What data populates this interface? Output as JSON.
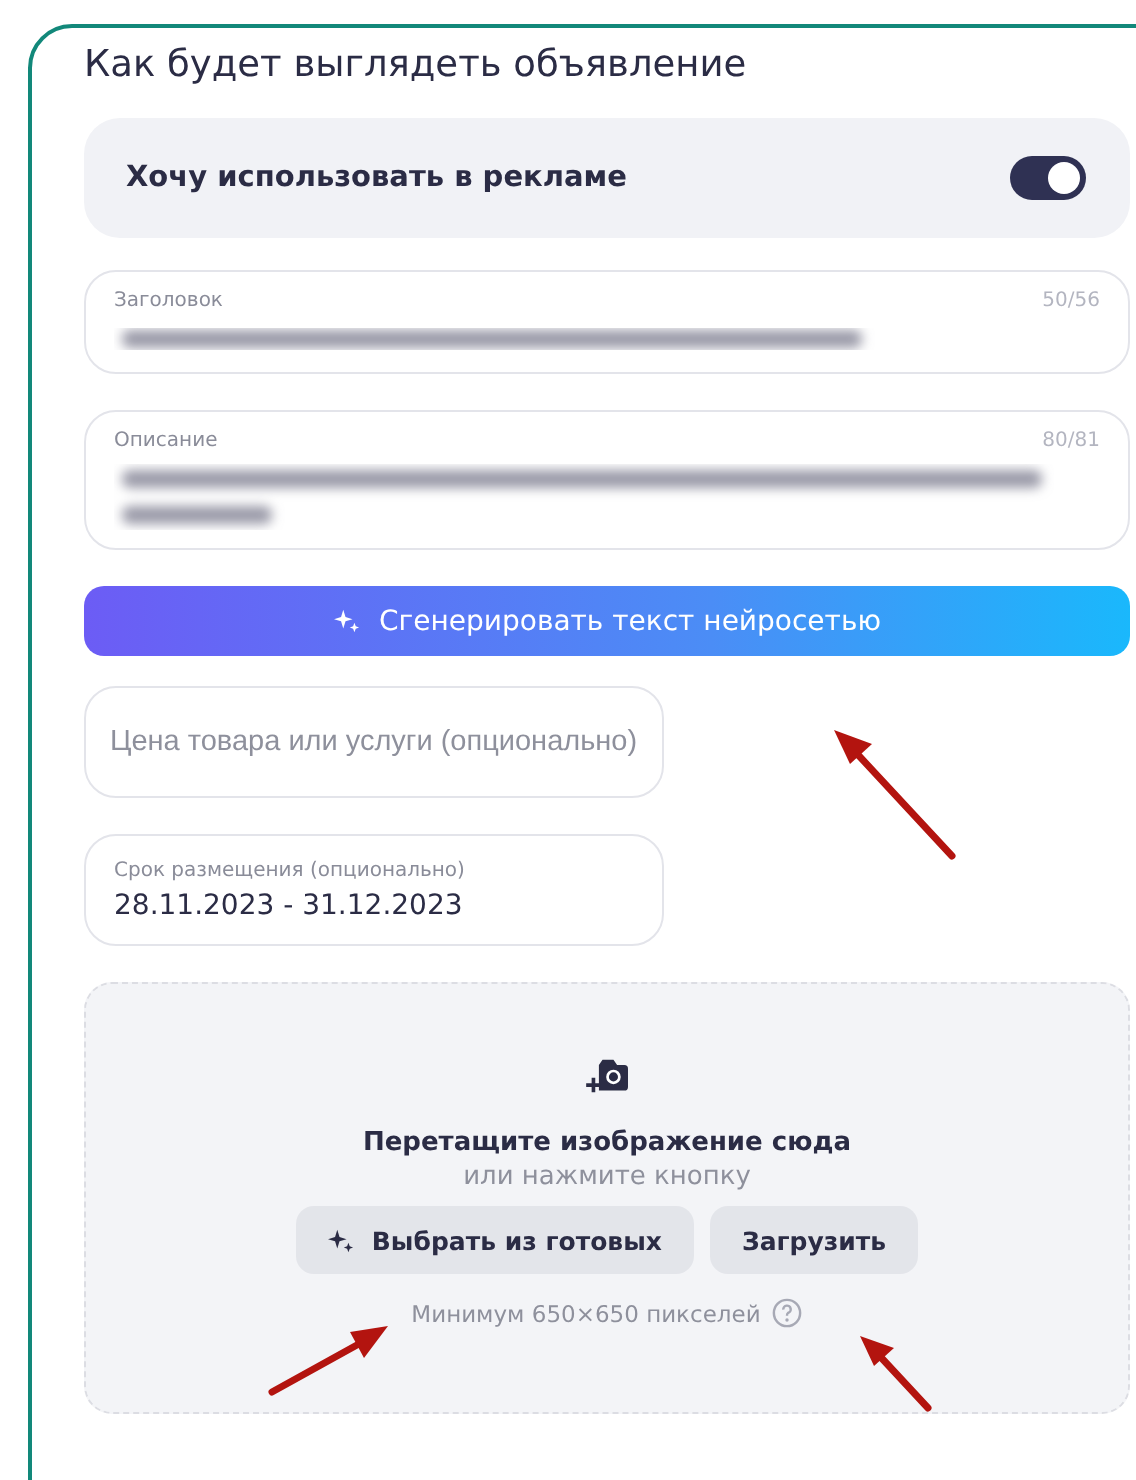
{
  "title": "Как будет выглядеть объявление",
  "ad_toggle": {
    "label": "Хочу использовать в рекламе",
    "on": true
  },
  "fields": [
    {
      "kind": "short_text",
      "label": "Заголовок",
      "counter": "50/56"
    },
    {
      "kind": "long_text",
      "label": "Описание",
      "counter": "80/81"
    },
    {
      "kind": "button",
      "label": "Сгенерировать текст нейросетью"
    },
    {
      "kind": "empty",
      "placeholder": "Цена товара или услуги (опционально)"
    },
    {
      "kind": "filled",
      "label": "Срок размещения (опционально)",
      "value": "28.11.2023 - 31.12.2023"
    }
  ],
  "upload": {
    "heading": "Перетащите изображение сюда",
    "subtext": "или нажмите кнопку",
    "buttons": [
      {
        "label": "Выбрать из готовых",
        "kind": "ai"
      },
      {
        "label": "Загрузить",
        "kind": "plain"
      }
    ],
    "hint": "Минимум 650×650 пикселей"
  }
}
